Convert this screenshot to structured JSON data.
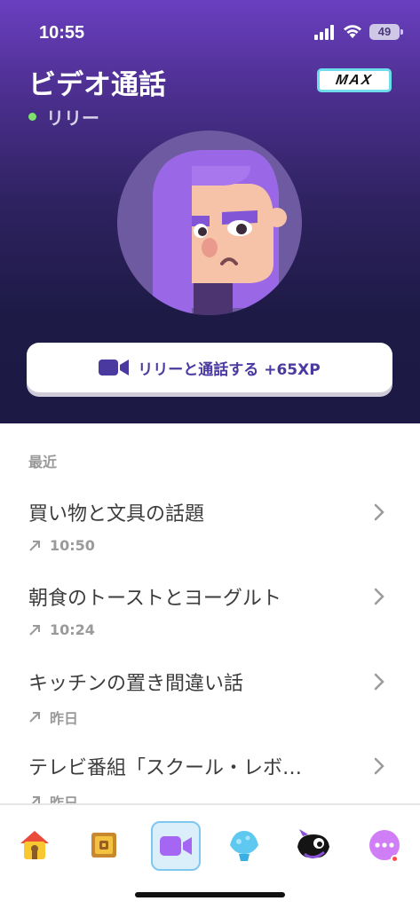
{
  "status": {
    "time": "10:55",
    "battery": "49"
  },
  "header": {
    "title": "ビデオ通話",
    "badge": "MAX",
    "contact_name": "リリー"
  },
  "call_button": {
    "label": "リリーと通話する +65XP"
  },
  "recent": {
    "heading": "最近",
    "items": [
      {
        "title": "買い物と文具の話題",
        "time": "10:50"
      },
      {
        "title": "朝食のトーストとヨーグルト",
        "time": "10:24"
      },
      {
        "title": "キッチンの置き間違い話",
        "time": "昨日"
      },
      {
        "title": "テレビ番組「スクール・レボ…",
        "time": "昨日"
      }
    ]
  },
  "tabs": [
    "home-icon",
    "treasure-chest-icon",
    "video-call-icon",
    "shell-icon",
    "skull-icon",
    "more-icon"
  ],
  "colors": {
    "accent": "#4a3aa0",
    "online": "#7ee26a",
    "active_tab_bg": "#dbeffb"
  }
}
